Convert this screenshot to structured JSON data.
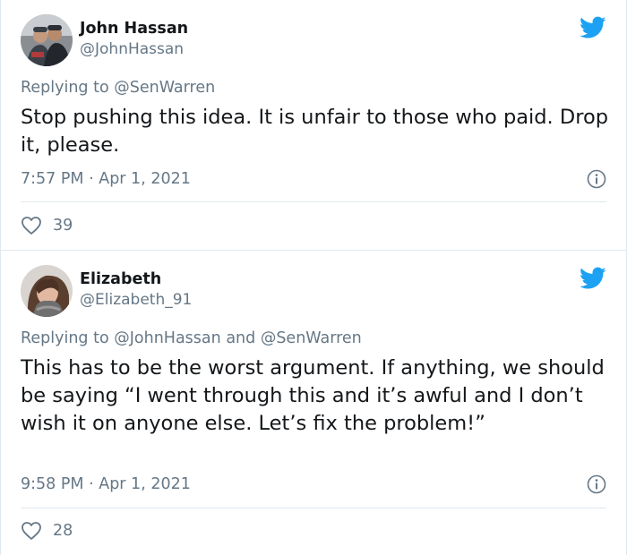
{
  "theme": {
    "text": "#14171a",
    "secondary": "#657786",
    "twitter_blue": "#1da1f2",
    "border": "#e1e8ed"
  },
  "tweets": [
    {
      "author_name": "John Hassan",
      "author_handle": "@JohnHassan",
      "replying_prefix": "Replying to",
      "replying_to": [
        "@SenWarren"
      ],
      "replying_joiner": "",
      "text": "Stop pushing this idea. It is unfair to those who paid. Drop it, please.",
      "time": "7:57 PM",
      "date_sep": " · ",
      "date": "Apr 1, 2021",
      "likes": "39",
      "icons": {
        "logo": "twitter-bird-icon",
        "info": "info-icon",
        "like": "heart-icon"
      }
    },
    {
      "author_name": "Elizabeth",
      "author_handle": "@Elizabeth_91",
      "replying_prefix": "Replying to",
      "replying_to": [
        "@JohnHassan",
        "@SenWarren"
      ],
      "replying_joiner": "and",
      "text": "This has to be the worst argument. If anything, we should be saying “I went through this and it’s awful and I don’t wish it on anyone else. Let’s fix the problem!”",
      "time": "9:58 PM",
      "date_sep": " · ",
      "date": "Apr 1, 2021",
      "likes": "28",
      "icons": {
        "logo": "twitter-bird-icon",
        "info": "info-icon",
        "like": "heart-icon"
      }
    }
  ]
}
